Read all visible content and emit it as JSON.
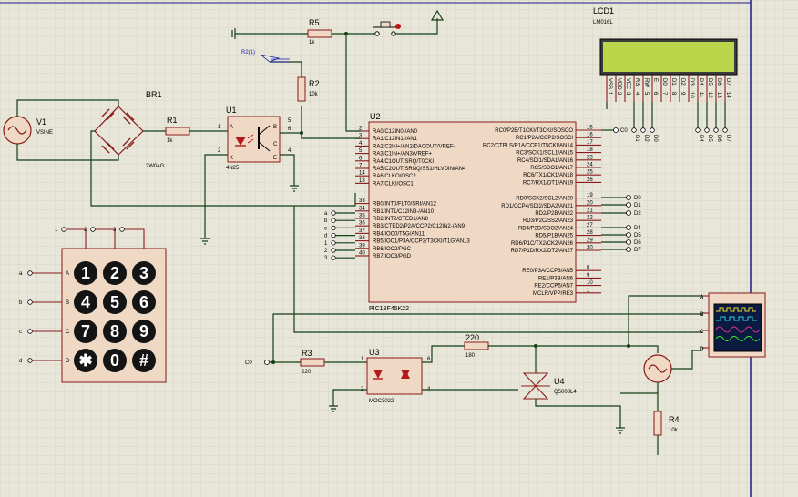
{
  "pic": {
    "ref": "U2",
    "part": "PIC18F45K22",
    "left_pins": [
      {
        "num": "2",
        "name": "RA0/C12IN0-/AN0"
      },
      {
        "num": "3",
        "name": "RA1/C12IN1-/AN1"
      },
      {
        "num": "4",
        "name": "RA2/C2IN+/AN2/DACOUT/VREF-"
      },
      {
        "num": "5",
        "name": "RA3/C1IN+/AN3/VREF+"
      },
      {
        "num": "6",
        "name": "RA4/C1OUT/SRQ/T0CKI"
      },
      {
        "num": "7",
        "name": "RA5/C2OUT/SRNQ/SS1/HLVDIN/AN4"
      },
      {
        "num": "14",
        "name": "RA6/CLKO/OSC2"
      },
      {
        "num": "13",
        "name": "RA7/CLKI/OSC1"
      },
      {
        "num": "33",
        "name": "RB0/INT0/FLT0/SRI/AN12"
      },
      {
        "num": "34",
        "name": "RB1/INT1/C12IN3-/AN10"
      },
      {
        "num": "35",
        "name": "RB2/INT2/CTED1/AN8"
      },
      {
        "num": "36",
        "name": "RB3/CTED2/P2A/CCP2/C12IN2-/AN9"
      },
      {
        "num": "37",
        "name": "RB4/IOC0/T5G/AN11"
      },
      {
        "num": "38",
        "name": "RB5/IOC1/P3A/CCP3/T3CKI/T1G/AN13"
      },
      {
        "num": "39",
        "name": "RB6/IOC2/PGC"
      },
      {
        "num": "40",
        "name": "RB7/IOC3/PGD"
      }
    ],
    "right_pins": [
      {
        "num": "15",
        "name": "RC0/P2B/T1CKI/T3CKI/SOSCO"
      },
      {
        "num": "16",
        "name": "RC1/P2A/CCP2/SOSCI"
      },
      {
        "num": "17",
        "name": "RC2/CTPLS/P1A/CCP1/T5CKI/AN14"
      },
      {
        "num": "18",
        "name": "RC3/SCK1/SCL1/AN15"
      },
      {
        "num": "23",
        "name": "RC4/SDI1/SDA1/AN16"
      },
      {
        "num": "24",
        "name": "RC5/SDO1/AN17"
      },
      {
        "num": "25",
        "name": "RC6/TX1/CK1/AN18"
      },
      {
        "num": "26",
        "name": "RC7/RX1/DT1/AN19"
      },
      {
        "num": "19",
        "name": "RD0/SCK2/SCL2/AN20"
      },
      {
        "num": "20",
        "name": "RD1/CCP4/SDI2/SDA2/AN21"
      },
      {
        "num": "21",
        "name": "RD2/P2B/AN22"
      },
      {
        "num": "22",
        "name": "RD3/P2C/SS2/AN23"
      },
      {
        "num": "27",
        "name": "RD4/P2D/SDO2/AN24"
      },
      {
        "num": "28",
        "name": "RD5/P1B/AN25"
      },
      {
        "num": "29",
        "name": "RD6/P1C/TX2/CK2/AN26"
      },
      {
        "num": "30",
        "name": "RD7/P1D/RX2/DT2/AN27"
      },
      {
        "num": "8",
        "name": "RE0/P3A/CCP3/AN5"
      },
      {
        "num": "9",
        "name": "RE1/P3B/AN6"
      },
      {
        "num": "10",
        "name": "RE2/CCP5/AN7"
      },
      {
        "num": "1",
        "name": "MCLR/VPP/RE3"
      }
    ],
    "rb_terminals": [
      "a",
      "b",
      "c",
      "d",
      "1",
      "2",
      "3"
    ],
    "rd_terminals": [
      "D0",
      "D1",
      "D2",
      "D4",
      "D5",
      "D6",
      "D7"
    ],
    "c0_label": "C0"
  },
  "lcd": {
    "ref": "LCD1",
    "part": "LM016L",
    "pins": [
      {
        "name": "VSS",
        "num": "1"
      },
      {
        "name": "VDD",
        "num": "2"
      },
      {
        "name": "VEE",
        "num": "3"
      },
      {
        "name": "RS",
        "num": "4"
      },
      {
        "name": "RW",
        "num": "5"
      },
      {
        "name": "E",
        "num": "6"
      },
      {
        "name": "D0",
        "num": "7"
      },
      {
        "name": "D1",
        "num": "8"
      },
      {
        "name": "D2",
        "num": "9"
      },
      {
        "name": "D3",
        "num": "10"
      },
      {
        "name": "D4",
        "num": "11"
      },
      {
        "name": "D5",
        "num": "12"
      },
      {
        "name": "D6",
        "num": "13"
      },
      {
        "name": "D7",
        "num": "14"
      }
    ],
    "rs_labels": [
      "D1",
      "D2",
      "D0"
    ],
    "data_labels": [
      "D4",
      "D5",
      "D6",
      "D7"
    ],
    "c0_label": "C0"
  },
  "source": {
    "ref": "V1",
    "model": "VSINE"
  },
  "bridge": {
    "ref": "BR1",
    "part": "2W04G"
  },
  "r1": {
    "ref": "R1",
    "value": "1k"
  },
  "u1": {
    "ref": "U1",
    "part": "4N25",
    "pins": [
      "1",
      "2",
      "4",
      "5",
      "6"
    ],
    "pin_letters": [
      "A",
      "K",
      "B",
      "C",
      "E"
    ]
  },
  "r5": {
    "ref": "R5",
    "value": "1k"
  },
  "r2": {
    "ref": "R2",
    "value": "10k"
  },
  "probe": {
    "label": "R2(1)"
  },
  "keypad": {
    "col_labels": [
      "1",
      "2",
      "3"
    ],
    "row_labels": [
      "a",
      "b",
      "c",
      "d"
    ],
    "row_letters": [
      "A",
      "B",
      "C",
      "D"
    ],
    "keys": [
      "1",
      "2",
      "3",
      "4",
      "5",
      "6",
      "7",
      "8",
      "9",
      "✱",
      "0",
      "#"
    ]
  },
  "r3": {
    "ref": "R3",
    "value": "220",
    "net": "C0",
    "pin": "6"
  },
  "u3": {
    "ref": "U3",
    "part": "MOC3022",
    "pins": [
      "1",
      "2",
      "6",
      "4"
    ]
  },
  "r_top": {
    "value_label": "220",
    "value": "180"
  },
  "u4": {
    "ref": "U4",
    "part": "Q5008L4"
  },
  "r4": {
    "ref": "R4",
    "value": "10k"
  },
  "scope": {
    "channels": [
      "A",
      "B",
      "C",
      "D"
    ]
  },
  "colors": {
    "wire": "#133f14",
    "body": "#efd8c4",
    "outline": "#8a1a1a",
    "lcd_screen": "#bcd64c",
    "scope": "#0a1a40",
    "keypad": "#efd8c4"
  }
}
